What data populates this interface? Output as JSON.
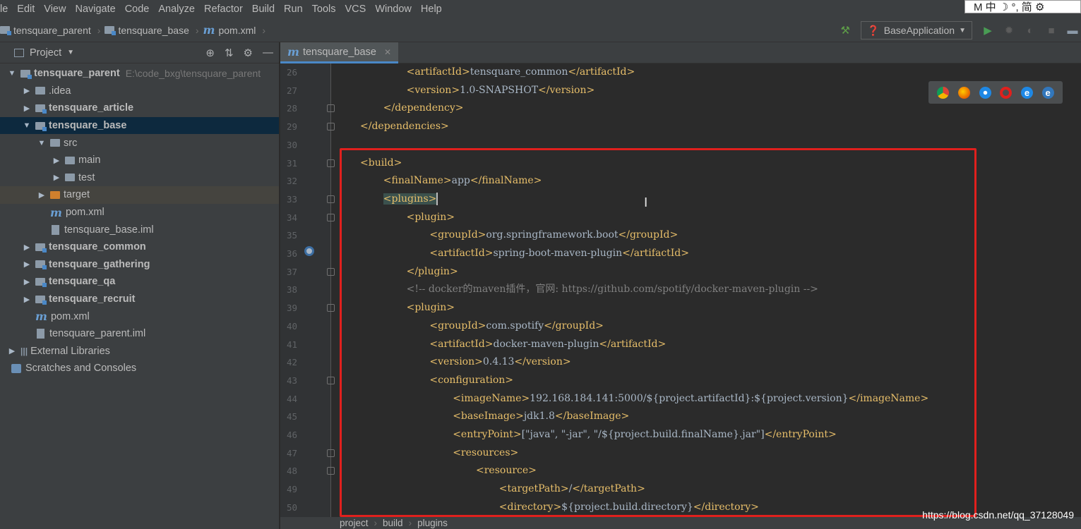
{
  "menu": [
    "le",
    "Edit",
    "View",
    "Navigate",
    "Code",
    "Analyze",
    "Refactor",
    "Build",
    "Run",
    "Tools",
    "VCS",
    "Window",
    "Help"
  ],
  "ime": {
    "text": "M 中 ☽ °, 简 ⚙"
  },
  "breadcrumb": [
    "tensquare_parent",
    "tensquare_base",
    "pom.xml"
  ],
  "run_config": "BaseApplication",
  "project_panel": {
    "title": "Project",
    "tree": [
      {
        "label": "tensquare_parent",
        "hint": "E:\\code_bxg\\tensquare_parent",
        "indent": 0,
        "arrow": "▼",
        "icon": "module",
        "bold": true
      },
      {
        "label": ".idea",
        "indent": 1,
        "arrow": "▶",
        "icon": "folder"
      },
      {
        "label": "tensquare_article",
        "indent": 1,
        "arrow": "▶",
        "icon": "module",
        "bold": true
      },
      {
        "label": "tensquare_base",
        "indent": 1,
        "arrow": "▼",
        "icon": "module",
        "bold": true,
        "selected": true
      },
      {
        "label": "src",
        "indent": 2,
        "arrow": "▼",
        "icon": "folder"
      },
      {
        "label": "main",
        "indent": 3,
        "arrow": "▶",
        "icon": "folder"
      },
      {
        "label": "test",
        "indent": 3,
        "arrow": "▶",
        "icon": "folder"
      },
      {
        "label": "target",
        "indent": 2,
        "arrow": "▶",
        "icon": "folder-orange",
        "highlight": true
      },
      {
        "label": "pom.xml",
        "indent": 2,
        "arrow": "",
        "icon": "maven"
      },
      {
        "label": "tensquare_base.iml",
        "indent": 2,
        "arrow": "",
        "icon": "file"
      },
      {
        "label": "tensquare_common",
        "indent": 1,
        "arrow": "▶",
        "icon": "module",
        "bold": true
      },
      {
        "label": "tensquare_gathering",
        "indent": 1,
        "arrow": "▶",
        "icon": "module",
        "bold": true
      },
      {
        "label": "tensquare_qa",
        "indent": 1,
        "arrow": "▶",
        "icon": "module",
        "bold": true
      },
      {
        "label": "tensquare_recruit",
        "indent": 1,
        "arrow": "▶",
        "icon": "module",
        "bold": true
      },
      {
        "label": "pom.xml",
        "indent": 1,
        "arrow": "",
        "icon": "maven"
      },
      {
        "label": "tensquare_parent.iml",
        "indent": 1,
        "arrow": "",
        "icon": "file"
      },
      {
        "label": "External Libraries",
        "indent": 0,
        "arrow": "▶",
        "icon": "library"
      },
      {
        "label": "Scratches and Consoles",
        "indent": 0,
        "arrow": "",
        "icon": "scratch"
      }
    ]
  },
  "editor_tab": "tensquare_base",
  "code_lines": [
    {
      "n": "26",
      "indent": 2,
      "parts": [
        [
          "t",
          "<artifactId>"
        ],
        [
          "v",
          "tensquare_common"
        ],
        [
          "t",
          "</artifactId>"
        ]
      ]
    },
    {
      "n": "27",
      "indent": 2,
      "parts": [
        [
          "t",
          "<version>"
        ],
        [
          "v",
          "1.0-SNAPSHOT"
        ],
        [
          "t",
          "</version>"
        ]
      ]
    },
    {
      "n": "28",
      "indent": 1,
      "fold": true,
      "parts": [
        [
          "t",
          "</dependency>"
        ]
      ]
    },
    {
      "n": "29",
      "indent": 0,
      "fold": true,
      "parts": [
        [
          "t",
          "</dependencies>"
        ]
      ]
    },
    {
      "n": "30",
      "indent": 0,
      "parts": []
    },
    {
      "n": "31",
      "indent": 0,
      "fold": true,
      "parts": [
        [
          "t",
          "<build>"
        ]
      ]
    },
    {
      "n": "32",
      "indent": 1,
      "parts": [
        [
          "t",
          "<finalName>"
        ],
        [
          "v",
          "app"
        ],
        [
          "t",
          "</finalName>"
        ]
      ]
    },
    {
      "n": "33",
      "indent": 1,
      "fold": true,
      "parts": [
        [
          "h",
          "<plugins>"
        ],
        [
          "c",
          ""
        ]
      ]
    },
    {
      "n": "34",
      "indent": 2,
      "fold": true,
      "parts": [
        [
          "t",
          "<plugin>"
        ]
      ]
    },
    {
      "n": "35",
      "indent": 3,
      "parts": [
        [
          "t",
          "<groupId>"
        ],
        [
          "v",
          "org.springframework.boot"
        ],
        [
          "t",
          "</groupId>"
        ]
      ]
    },
    {
      "n": "36",
      "indent": 3,
      "parts": [
        [
          "t",
          "<artifactId>"
        ],
        [
          "v",
          "spring-boot-maven-plugin"
        ],
        [
          "t",
          "</artifactId>"
        ]
      ]
    },
    {
      "n": "37",
      "indent": 2,
      "fold": true,
      "parts": [
        [
          "t",
          "</plugin>"
        ]
      ]
    },
    {
      "n": "38",
      "indent": 2,
      "parts": [
        [
          "m",
          "<!-- docker的maven插件，官网: https://github.com/spotify/docker-maven-plugin -->"
        ]
      ]
    },
    {
      "n": "39",
      "indent": 2,
      "fold": true,
      "parts": [
        [
          "t",
          "<plugin>"
        ]
      ]
    },
    {
      "n": "40",
      "indent": 3,
      "parts": [
        [
          "t",
          "<groupId>"
        ],
        [
          "v",
          "com.spotify"
        ],
        [
          "t",
          "</groupId>"
        ]
      ]
    },
    {
      "n": "41",
      "indent": 3,
      "parts": [
        [
          "t",
          "<artifactId>"
        ],
        [
          "v",
          "docker-maven-plugin"
        ],
        [
          "t",
          "</artifactId>"
        ]
      ]
    },
    {
      "n": "42",
      "indent": 3,
      "parts": [
        [
          "t",
          "<version>"
        ],
        [
          "v",
          "0.4.13"
        ],
        [
          "t",
          "</version>"
        ]
      ]
    },
    {
      "n": "43",
      "indent": 3,
      "fold": true,
      "parts": [
        [
          "t",
          "<configuration>"
        ]
      ]
    },
    {
      "n": "44",
      "indent": 4,
      "parts": [
        [
          "t",
          "<imageName>"
        ],
        [
          "v",
          "192.168.184.141:5000/${project.artifactId}:${project.version}"
        ],
        [
          "t",
          "</imageName>"
        ]
      ]
    },
    {
      "n": "45",
      "indent": 4,
      "parts": [
        [
          "t",
          "<baseImage>"
        ],
        [
          "v",
          "jdk1.8"
        ],
        [
          "t",
          "</baseImage>"
        ]
      ]
    },
    {
      "n": "46",
      "indent": 4,
      "parts": [
        [
          "t",
          "<entryPoint>"
        ],
        [
          "v",
          "[\"java\", \"-jar\", \"/${project.build.finalName}.jar\"]"
        ],
        [
          "t",
          "</entryPoint>"
        ]
      ]
    },
    {
      "n": "47",
      "indent": 4,
      "fold": true,
      "parts": [
        [
          "t",
          "<resources>"
        ]
      ]
    },
    {
      "n": "48",
      "indent": 5,
      "fold": true,
      "parts": [
        [
          "t",
          "<resource>"
        ]
      ]
    },
    {
      "n": "49",
      "indent": 6,
      "parts": [
        [
          "t",
          "<targetPath>"
        ],
        [
          "v",
          "/"
        ],
        [
          "t",
          "</targetPath>"
        ]
      ]
    },
    {
      "n": "50",
      "indent": 6,
      "parts": [
        [
          "t",
          "<directory>"
        ],
        [
          "v",
          "${project.build.directory}"
        ],
        [
          "t",
          "</directory>"
        ]
      ]
    }
  ],
  "status_path": [
    "project",
    "build",
    "plugins"
  ],
  "watermark": "https://blog.csdn.net/qq_37128049",
  "colors": {
    "tag": "#e8bf6a",
    "text": "#a9b7c6",
    "comment": "#808080",
    "highlight_box": "#e0201d",
    "selection": "#0d293e"
  }
}
